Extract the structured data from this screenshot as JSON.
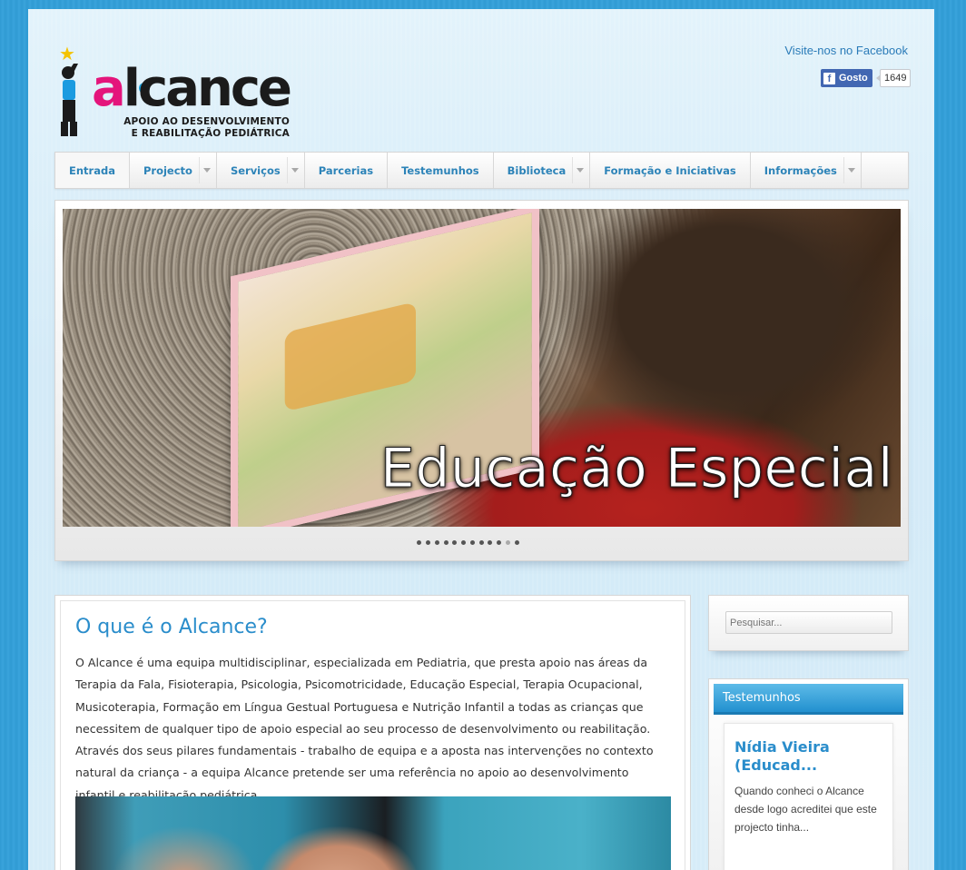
{
  "brand": {
    "name": "alcance",
    "tagline_line1": "APOIO AO DESENVOLVIMENTO",
    "tagline_line2": "E REABILITAÇÃO PEDIÁTRICA",
    "colors": {
      "magenta": "#e4157b",
      "yellow": "#ffd400",
      "cyan": "#18a0dc",
      "accent": "#2a8dcb"
    }
  },
  "header": {
    "facebook_link": "Visite-nos no Facebook",
    "like_label": "Gosto",
    "like_count": "1649",
    "like_icon": "facebook-f-icon"
  },
  "nav": {
    "items": [
      {
        "label": "Entrada",
        "has_sub": false,
        "active": true
      },
      {
        "label": "Projecto",
        "has_sub": true
      },
      {
        "label": "Serviços",
        "has_sub": true
      },
      {
        "label": "Parcerias",
        "has_sub": false
      },
      {
        "label": "Testemunhos",
        "has_sub": false
      },
      {
        "label": "Biblioteca",
        "has_sub": true
      },
      {
        "label": "Formação e Iniciativas",
        "has_sub": false
      },
      {
        "label": "Informações",
        "has_sub": true
      }
    ]
  },
  "slider": {
    "caption": "Educação Especial",
    "dot_count": 11,
    "active_dot": 10
  },
  "main": {
    "title": "O que é o Alcance?",
    "body": "O Alcance é uma equipa multidisciplinar, especializada em Pediatria, que presta apoio nas áreas da Terapia da Fala, Fisioterapia, Psicologia, Psicomotricidade, Educação Especial, Terapia Ocupacional, Musicoterapia, Formação em Língua Gestual Portuguesa e Nutrição Infantil a todas as crianças que necessitem de qualquer tipo de apoio especial ao seu processo de desenvolvimento ou reabilitação. Através dos seus pilares fundamentais - trabalho de equipa e a aposta nas intervenções no contexto natural da criança - a equipa Alcance pretende ser uma referência no apoio ao desenvolvimento infantil e reabilitação pediátrica."
  },
  "sidebar": {
    "search_placeholder": "Pesquisar...",
    "testimonials": {
      "heading": "Testemunhos",
      "name": "Nídia Vieira (Educad...",
      "excerpt": "Quando conheci o Alcance desde logo acreditei que este projecto tinha..."
    }
  }
}
